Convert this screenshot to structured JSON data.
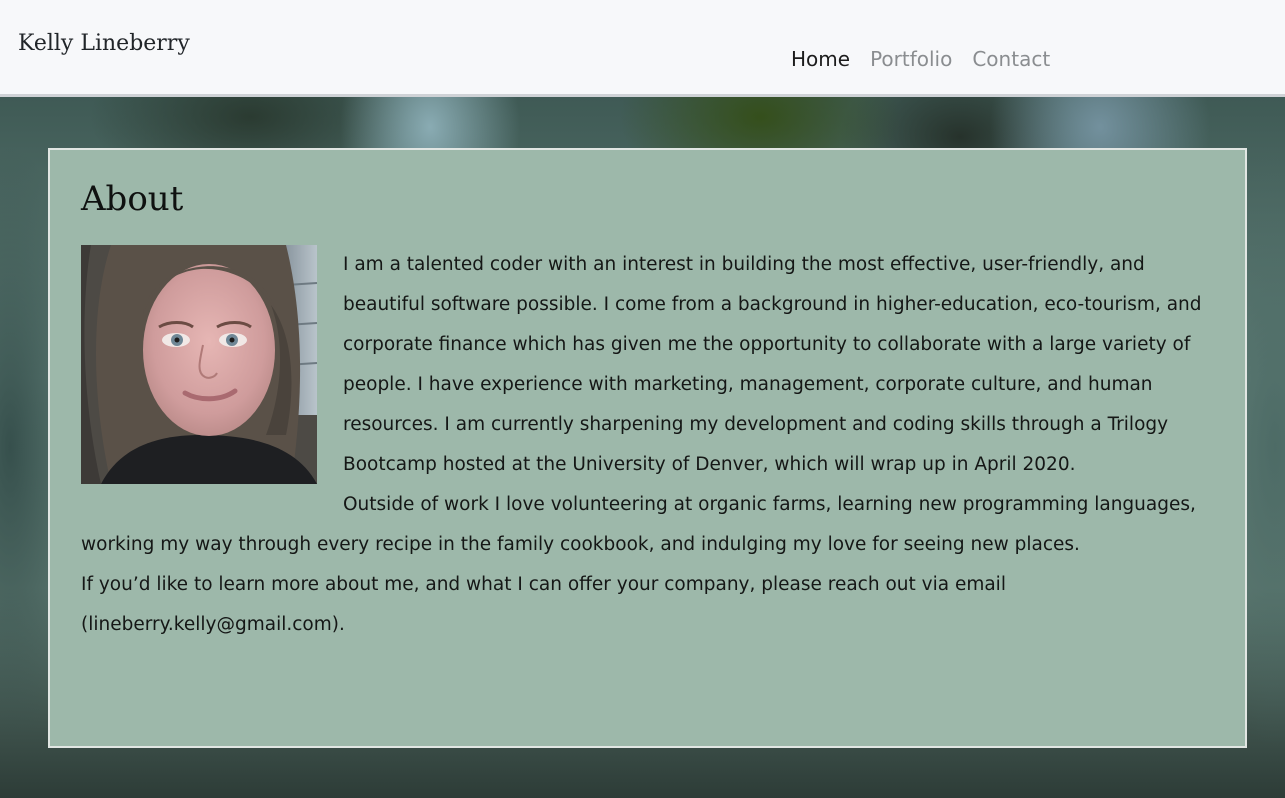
{
  "header": {
    "brand": "Kelly Lineberry",
    "nav": [
      {
        "label": "Home",
        "active": true
      },
      {
        "label": "Portfolio",
        "active": false
      },
      {
        "label": "Contact",
        "active": false
      }
    ]
  },
  "about": {
    "title": "About",
    "paragraphs": [
      "I am a talented coder with an interest in building the most effective, user-friendly, and beautiful software possible. I come from a background in higher-education, eco-tourism, and corporate finance which has given me the opportunity to collaborate with a large variety of people. I have experience with marketing, management, corporate culture, and human resources. I am currently sharpening my development and coding skills through a Trilogy Bootcamp hosted at the University of Denver, which will wrap up in April 2020.",
      "Outside of work I love volunteering at organic farms, learning new programming languages, working my way through every recipe in the family cookbook, and indulging my love for seeing new places.",
      "If you’d like to learn more about me, and what I can offer your company, please reach out via email (lineberry.kelly@gmail.com)."
    ]
  },
  "colors": {
    "navbar_bg": "#f7f8fa",
    "card_bg": "#9db8aa",
    "card_border": "#e1e6e3",
    "nav_active": "#1c1c1c",
    "nav_inactive": "#8a8d90"
  }
}
